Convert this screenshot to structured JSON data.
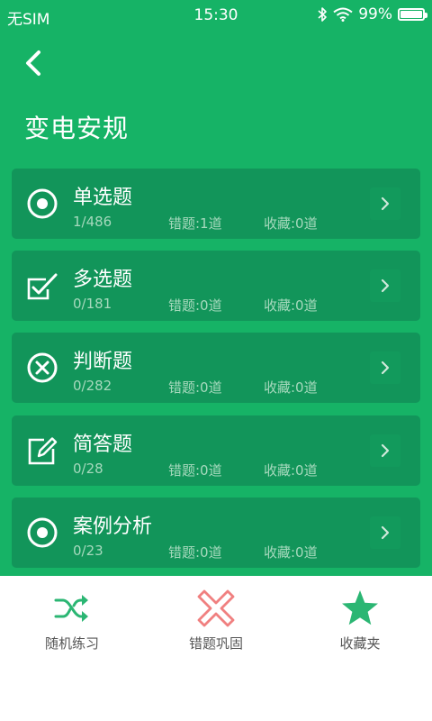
{
  "status_bar": {
    "carrier": "无SIM",
    "time": "15:30",
    "battery": "99%",
    "battery_level": 0.99
  },
  "header": {
    "back_icon": "chevron-left-icon",
    "title": "变电安规"
  },
  "categories": [
    {
      "title": "单选题",
      "progress": "1/486",
      "wrong": "错题:1道",
      "favorites": "收藏:0道",
      "icon": "radio-target-icon"
    },
    {
      "title": "多选题",
      "progress": "0/181",
      "wrong": "错题:0道",
      "favorites": "收藏:0道",
      "icon": "checkbox-checked-icon"
    },
    {
      "title": "判断题",
      "progress": "0/282",
      "wrong": "错题:0道",
      "favorites": "收藏:0道",
      "icon": "circle-x-icon"
    },
    {
      "title": "简答题",
      "progress": "0/28",
      "wrong": "错题:0道",
      "favorites": "收藏:0道",
      "icon": "edit-pencil-icon"
    },
    {
      "title": "案例分析",
      "progress": "0/23",
      "wrong": "错题:0道",
      "favorites": "收藏:0道",
      "icon": "radio-target-icon"
    }
  ],
  "bottom_tabs": [
    {
      "label": "随机练习",
      "icon": "shuffle-icon",
      "color": "#2bb673"
    },
    {
      "label": "错题巩固",
      "icon": "cross-icon",
      "color": "#f08080"
    },
    {
      "label": "收藏夹",
      "icon": "star-icon",
      "color": "#2bb673"
    }
  ],
  "colors": {
    "primary": "#16b366",
    "card": "#12955a",
    "meta_text": "#a6d9bd"
  }
}
